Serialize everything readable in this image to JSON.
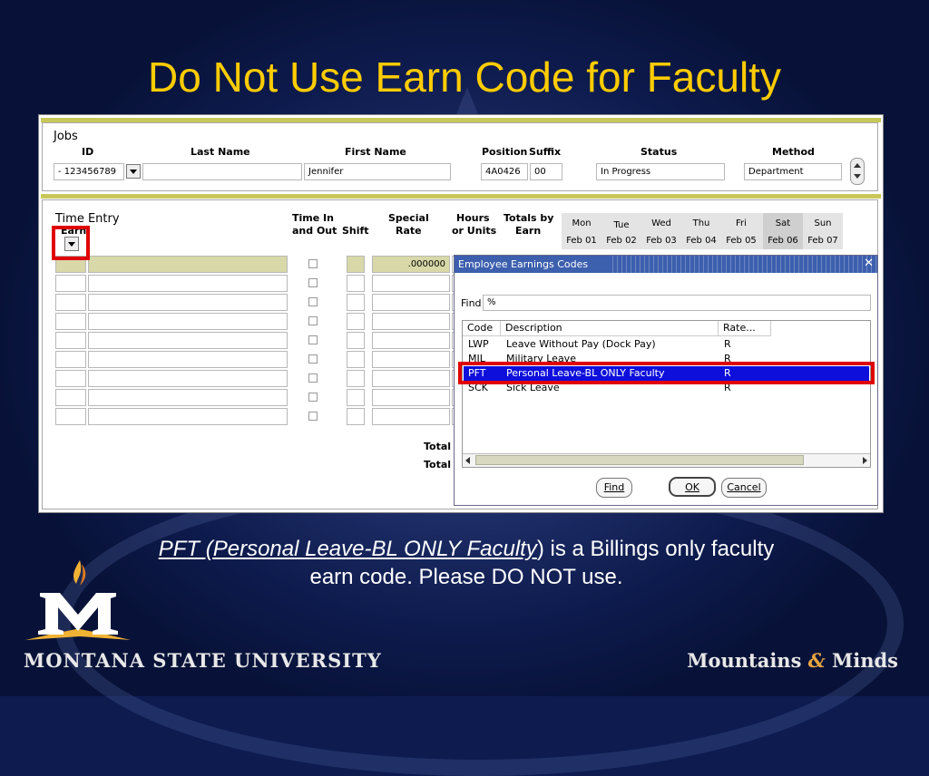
{
  "slide": {
    "title": "Do Not Use Earn Code for Faculty",
    "caption_code": "PFT (Personal Leave-BL ONLY Faculty",
    "caption_rest_1": ") is a Billings only faculty",
    "caption_rest_2": "earn code. Please DO NOT use.",
    "university": "MONTANA STATE UNIVERSITY",
    "tagline_left": "Mountains",
    "tagline_amp": "&",
    "tagline_right": "Minds",
    "logo_letter": "M"
  },
  "jobs": {
    "block_title": "Jobs",
    "headers": {
      "id": "ID",
      "last_name": "Last Name",
      "first_name": "First Name",
      "position": "Position",
      "suffix": "Suffix",
      "status": "Status",
      "method": "Method"
    },
    "values": {
      "id": "- 123456789",
      "last_name": "",
      "first_name": "Jennifer",
      "position": "4A0426",
      "suffix": "00",
      "status": "In Progress",
      "method": "Department"
    }
  },
  "time_entry": {
    "block_title": "Time Entry",
    "headers": {
      "earn": "Earn",
      "time_in_1": "Time In",
      "time_in_2": "and Out",
      "shift": "Shift",
      "special_1": "Special",
      "special_2": "Rate",
      "hours_1": "Hours",
      "hours_2": "or Units",
      "totals_1": "Totals by",
      "totals_2": "Earn"
    },
    "special_rate_value": ".000000",
    "days": [
      "Mon",
      "Tue",
      "Wed",
      "Thu",
      "Fri",
      "Sat",
      "Sun"
    ],
    "dates": [
      "Feb 01",
      "Feb 02",
      "Feb 03",
      "Feb 04",
      "Feb 05",
      "Feb 06",
      "Feb 07"
    ],
    "total_label_1": "Total",
    "total_label_2": "Total"
  },
  "dialog": {
    "title": "Employee Earnings Codes",
    "close_glyph": "✕",
    "find_label": "Find",
    "find_value": "%",
    "columns": {
      "code": "Code",
      "description": "Description",
      "rate": "Rate..."
    },
    "rows": [
      {
        "code": "LWP",
        "description": "Leave Without Pay (Dock Pay)",
        "rate": "R"
      },
      {
        "code": "MIL",
        "description": "Military Leave",
        "rate": "R"
      },
      {
        "code": "PFT",
        "description": "Personal Leave-BL ONLY Faculty",
        "rate": "R"
      },
      {
        "code": "SCK",
        "description": "Sick Leave",
        "rate": "R"
      }
    ],
    "buttons": {
      "find": "Find",
      "ok": "OK",
      "cancel": "Cancel"
    }
  },
  "colors": {
    "title": "#ffcc00",
    "highlight": "#e00000",
    "selected_row": "#0f0fdc",
    "dialog_title": "#3c5fae"
  }
}
